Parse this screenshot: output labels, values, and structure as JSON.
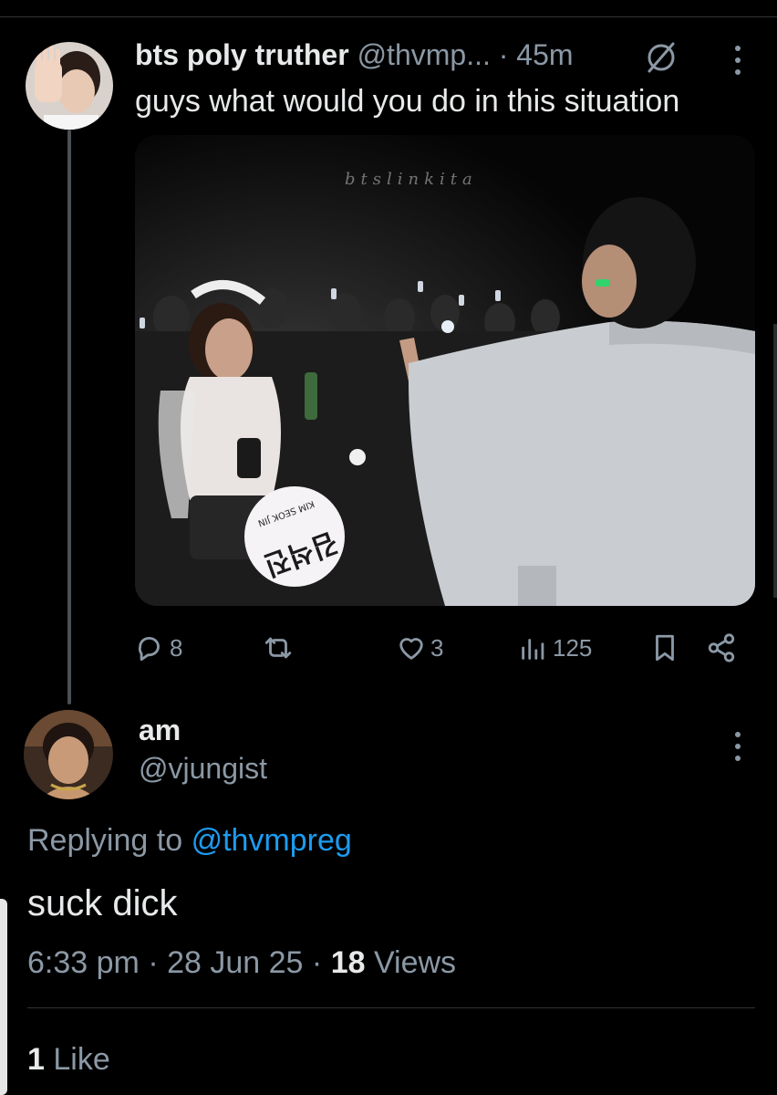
{
  "tweet": {
    "author_name": "bts poly truther",
    "handle": "@thvmp...",
    "separator": "·",
    "time": "45m",
    "text": "guys what would you do in this situation",
    "media": {
      "watermark": "btslinkita",
      "fan_sign_text": "김석진",
      "fan_sign_subtext": "KIM SEOK JIN"
    },
    "actions": {
      "replies": "8",
      "retweets": "",
      "likes": "3",
      "views": "125"
    }
  },
  "reply": {
    "author_name": "am",
    "handle": "@vjungist",
    "replying_label": "Replying to",
    "replying_to": "@thvmpreg",
    "text": "suck dick",
    "time": "6:33 pm",
    "separator": "·",
    "date": "28 Jun 25",
    "views_count": "18",
    "views_label": "Views",
    "likes_count": "1",
    "likes_label": "Like"
  },
  "colors": {
    "background": "#000000",
    "primary_text": "#e7e9ea",
    "secondary_text": "#8b98a5",
    "link": "#1d9bf0",
    "divider": "#2f3336"
  },
  "icons": [
    "grok-icon",
    "more-icon",
    "reply-icon",
    "retweet-icon",
    "like-icon",
    "views-icon",
    "bookmark-icon",
    "share-icon"
  ]
}
